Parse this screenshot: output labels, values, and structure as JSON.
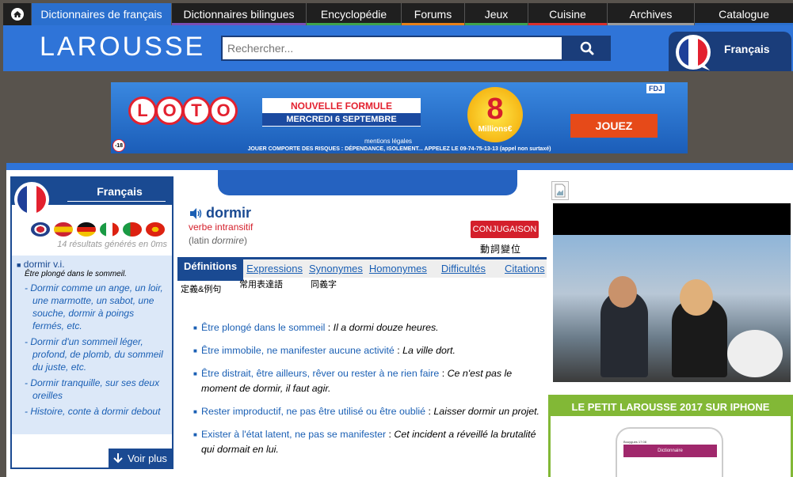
{
  "topnav": {
    "tabs": [
      {
        "label": "Dictionnaires de français",
        "color": "#2a6fce"
      },
      {
        "label": "Dictionnaires bilingues",
        "color": "#7a4fb5"
      },
      {
        "label": "Encyclopédie",
        "color": "#3fa34d"
      },
      {
        "label": "Forums",
        "color": "#e6801a"
      },
      {
        "label": "Jeux",
        "color": "#3fa34d"
      },
      {
        "label": "Cuisine",
        "color": "#d8302e"
      },
      {
        "label": "Archives",
        "color": "#9b9b9b"
      },
      {
        "label": "Catalogue",
        "color": "#2a6fce"
      }
    ]
  },
  "header": {
    "logo": "LAROUSSE",
    "search_placeholder": "Rechercher...",
    "language": "Français"
  },
  "ad": {
    "brand": [
      "L",
      "O",
      "T",
      "O"
    ],
    "headline": "NOUVELLE FORMULE",
    "date": "MERCREDI 6 SEPTEMBRE",
    "jackpot": "8",
    "jackpot_unit": "Millions€",
    "cta": "JOUEZ",
    "mentions": "mentions légales",
    "warning": "JOUER COMPORTE DES RISQUES : DÉPENDANCE, ISOLEMENT... APPELEZ LE 09-74-75-13-13 (appel non surtaxé)",
    "age": "-18",
    "sponsor": "FDJ"
  },
  "sidebar": {
    "title": "Français",
    "results": "14 résultats générés en 0ms",
    "entry": "dormir v.i.",
    "entry_def": "Être plongé dans le sommeil.",
    "subs": [
      "Dormir comme un ange, un loir, une marmotte, un sabot, une souche, dormir à poings fermés, etc.",
      "Dormir d'un sommeil léger, profond, de plomb, du sommeil du juste, etc.",
      "Dormir tranquille, sur ses deux oreilles",
      "Histoire, conte à dormir debout"
    ],
    "more": "Voir plus"
  },
  "main": {
    "word": "dormir",
    "pos": "verbe intransitif",
    "etym_prefix": "(latin ",
    "etym_word": "dormire",
    "etym_suffix": ")",
    "conj_label": "CONJUGAISON",
    "conj_note": "動詞變位",
    "tabs": [
      "Définitions",
      "Expressions",
      "Synonymes",
      "Homonymes",
      "Difficultés",
      "Citations"
    ],
    "tab_notes": [
      "定義&例句",
      "常用表達語",
      "同義字"
    ],
    "definitions": [
      {
        "meaning": "Être plongé dans le sommeil",
        "example": "Il a dormi douze heures."
      },
      {
        "meaning": "Être immobile, ne manifester aucune activité",
        "example": "La ville dort."
      },
      {
        "meaning": "Être distrait, être ailleurs, rêver ou rester à ne rien faire",
        "example": "Ce n'est pas le moment de dormir, il faut agir."
      },
      {
        "meaning": "Rester improductif, ne pas être utilisé ou être oublié",
        "example": "Laisser dormir un projet."
      },
      {
        "meaning": "Exister à l'état latent, ne pas se manifester",
        "example": "Cet incident a réveillé la brutalité qui dormait en lui."
      }
    ]
  },
  "right": {
    "promo_title": "LE PETIT LAROUSSE 2017 SUR IPHONE",
    "phone_status": "Bouygues      17:08",
    "phone_title": "Dictionnaire"
  }
}
